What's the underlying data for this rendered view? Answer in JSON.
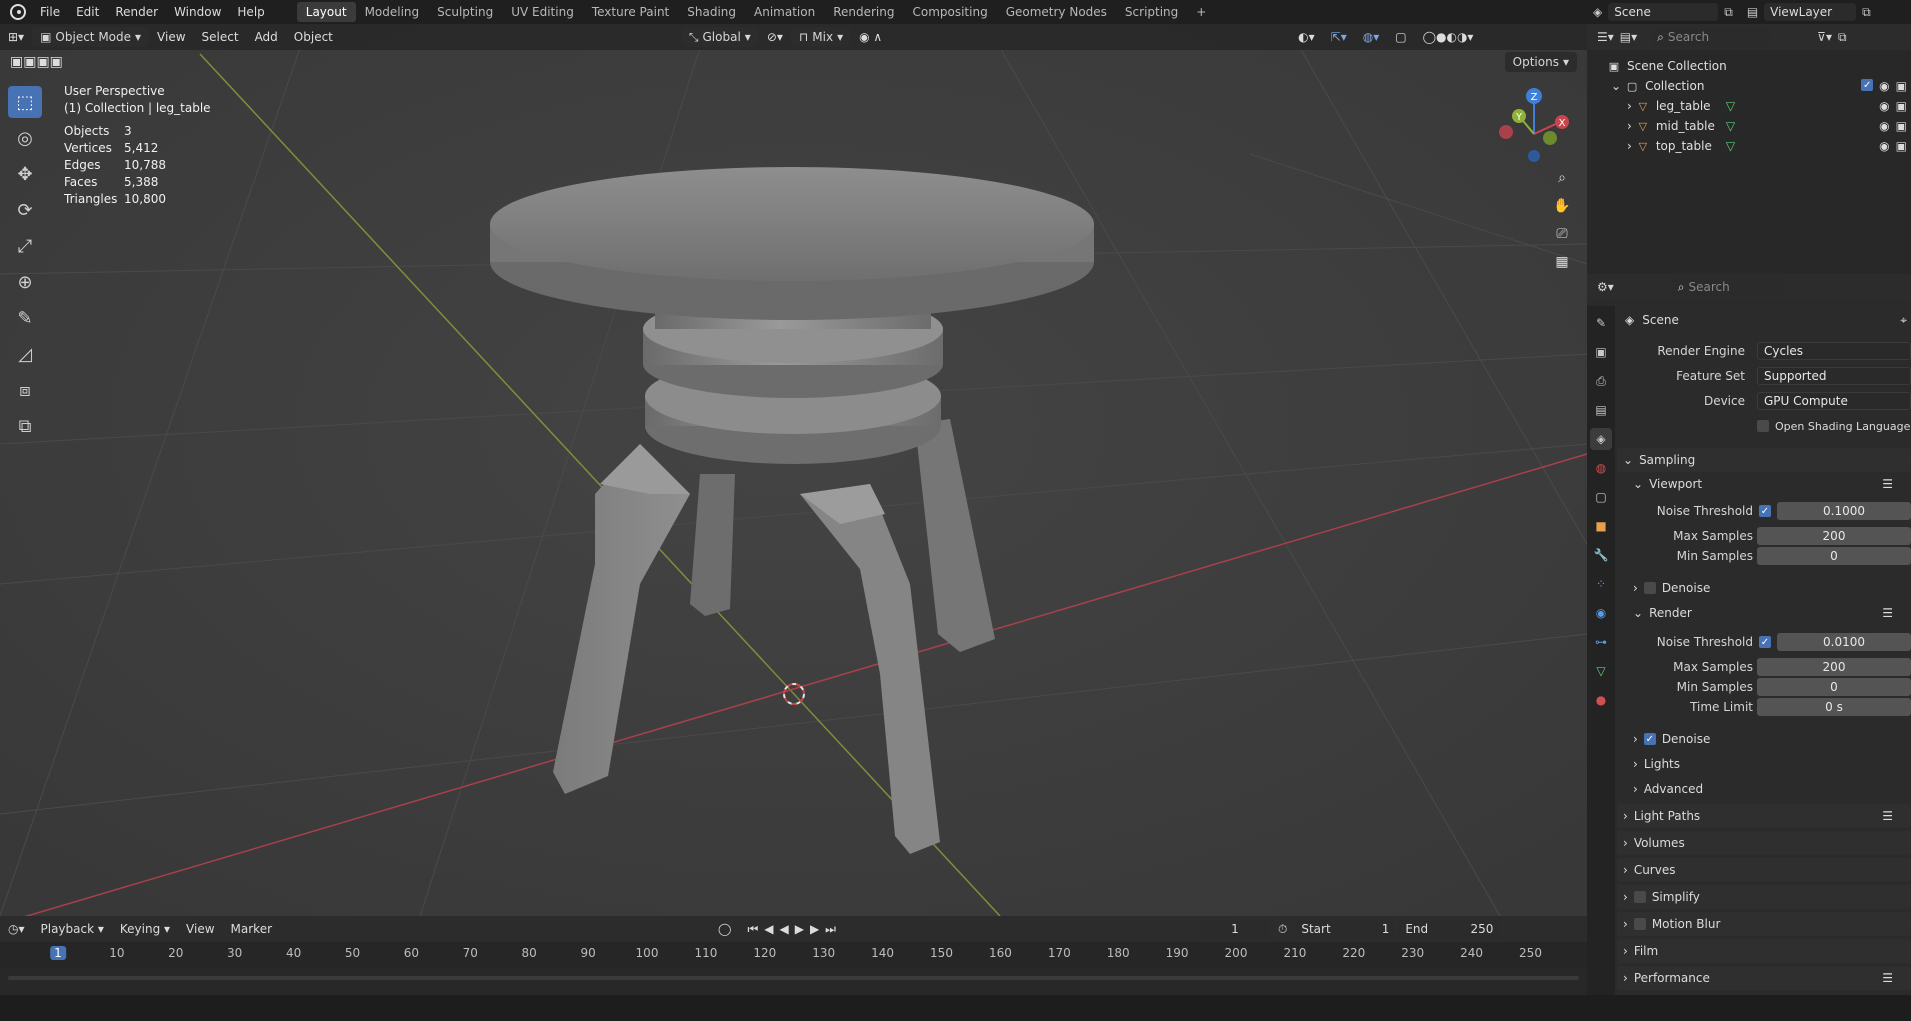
{
  "menu": {
    "items": [
      "File",
      "Edit",
      "Render",
      "Window",
      "Help"
    ],
    "workspaces": [
      "Layout",
      "Modeling",
      "Sculpting",
      "UV Editing",
      "Texture Paint",
      "Shading",
      "Animation",
      "Rendering",
      "Compositing",
      "Geometry Nodes",
      "Scripting"
    ],
    "active_workspace": "Layout"
  },
  "top_right": {
    "scene": "Scene",
    "view_layer": "ViewLayer"
  },
  "viewport": {
    "mode": "Object Mode",
    "menus": [
      "View",
      "Select",
      "Add",
      "Object"
    ],
    "transform_orientation": "Global",
    "snap": "Mix",
    "options": "Options",
    "overlay_title": "User Perspective",
    "overlay_subtitle": "(1) Collection | leg_table",
    "stats": [
      {
        "label": "Objects",
        "value": "3"
      },
      {
        "label": "Vertices",
        "value": "5,412"
      },
      {
        "label": "Edges",
        "value": "10,788"
      },
      {
        "label": "Faces",
        "value": "5,388"
      },
      {
        "label": "Triangles",
        "value": "10,800"
      }
    ],
    "gizmo_axes": [
      "Z",
      "Y",
      "X"
    ]
  },
  "timeline": {
    "menus": [
      "Playback",
      "Keying",
      "View",
      "Marker"
    ],
    "current_frame": "1",
    "start_label": "Start",
    "start": "1",
    "end_label": "End",
    "end": "250",
    "ruler": [
      "1",
      "10",
      "20",
      "30",
      "40",
      "50",
      "60",
      "70",
      "80",
      "90",
      "100",
      "110",
      "120",
      "130",
      "140",
      "150",
      "160",
      "170",
      "180",
      "190",
      "200",
      "210",
      "220",
      "230",
      "240",
      "250"
    ]
  },
  "outliner": {
    "search_placeholder": "Search",
    "scene_collection": "Scene Collection",
    "collection": "Collection",
    "objects": [
      "leg_table",
      "mid_table",
      "top_table"
    ]
  },
  "properties": {
    "search_placeholder": "Search",
    "context": "Scene",
    "render_engine_label": "Render Engine",
    "render_engine": "Cycles",
    "feature_set_label": "Feature Set",
    "feature_set": "Supported",
    "device_label": "Device",
    "device": "GPU Compute",
    "osl_label": "Open Shading Language",
    "sampling": "Sampling",
    "viewport": "Viewport",
    "render": "Render",
    "noise_threshold_label": "Noise Threshold",
    "max_samples_label": "Max Samples",
    "min_samples_label": "Min Samples",
    "time_limit_label": "Time Limit",
    "denoise_label": "Denoise",
    "vp_noise_threshold": "0.1000",
    "vp_max_samples": "200",
    "vp_min_samples": "0",
    "r_noise_threshold": "0.0100",
    "r_max_samples": "200",
    "r_min_samples": "0",
    "r_time_limit": "0 s",
    "lights": "Lights",
    "advanced": "Advanced",
    "sections": [
      "Light Paths",
      "Volumes",
      "Curves",
      "Simplify",
      "Motion Blur",
      "Film",
      "Performance"
    ]
  },
  "colors": {
    "accent": "#4772b3",
    "x_axis": "#c8454e",
    "y_axis": "#8fb13a",
    "z_axis": "#3f7fd6"
  }
}
